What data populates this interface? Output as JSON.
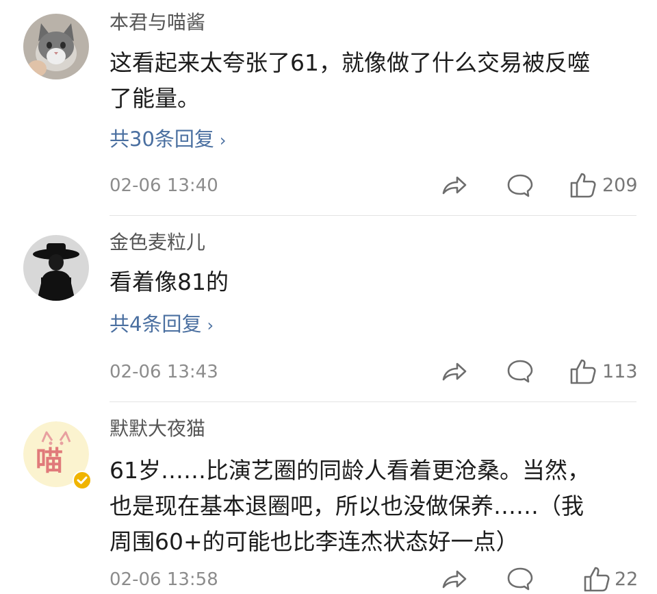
{
  "comments": [
    {
      "username": "本君与喵酱",
      "lines": [
        "这看起来太夸张了61，就像做了什么交易被反噬",
        "了能量。"
      ],
      "replies_label": "共30条回复",
      "timestamp": "02-06 13:40",
      "likes": "209",
      "avatar": "cat-avatar"
    },
    {
      "username": "金色麦粒儿",
      "lines": [
        "看着像81的"
      ],
      "replies_label": "共4条回复",
      "timestamp": "02-06 13:43",
      "likes": "113",
      "avatar": "hat-figure-avatar"
    },
    {
      "username": "默默大夜猫",
      "lines": [
        "61岁……比演艺圈的同龄人看着更沧桑。当然，",
        "也是现在基本退圈吧，所以也没做保养……（我",
        "周围60+的可能也比李连杰状态好一点）"
      ],
      "replies_label": "",
      "timestamp": "02-06 13:58",
      "likes": "22",
      "avatar": "cartoon-cat-avatar",
      "avatar_text": "喵"
    }
  ],
  "icons": {
    "share": "share-icon",
    "comment": "comment-icon",
    "like": "like-icon"
  },
  "colors": {
    "link": "#4a6fa0",
    "timestamp": "#8c8c8c",
    "username": "#555555",
    "verified_badge": "#f0b400"
  }
}
